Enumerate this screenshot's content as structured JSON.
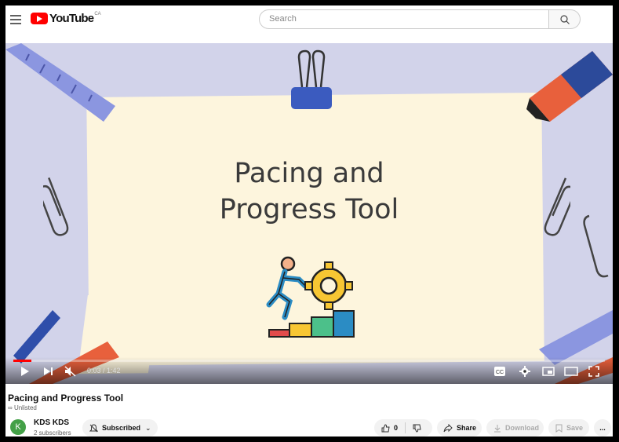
{
  "header": {
    "logo_text": "YouTube",
    "country_code": "CA",
    "search_placeholder": "Search"
  },
  "player": {
    "video_title_line1": "Pacing and",
    "video_title_line2": "Progress Tool",
    "time_display": "0:03 / 1:42",
    "progress": 0.03
  },
  "video": {
    "title": "Pacing and Progress Tool",
    "visibility": "Unlisted"
  },
  "channel": {
    "avatar_letter": "K",
    "name": "KDS KDS",
    "subscribers": "2 subscribers"
  },
  "actions": {
    "subscribed_label": "Subscribed",
    "like_count": "0",
    "share_label": "Share",
    "download_label": "Download",
    "save_label": "Save",
    "more_label": "..."
  }
}
